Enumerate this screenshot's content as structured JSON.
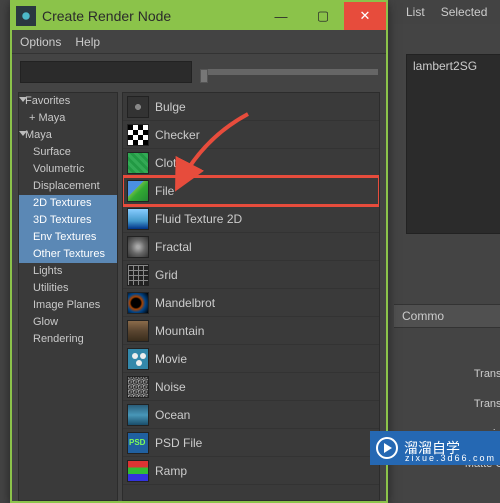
{
  "window": {
    "title": "Create Render Node",
    "min_glyph": "—",
    "max_glyph": "▢",
    "close_glyph": "✕"
  },
  "menu": {
    "options": "Options",
    "help": "Help"
  },
  "sidebar": {
    "items": [
      "Favorites",
      "+ Maya",
      "Maya",
      "Surface",
      "Volumetric",
      "Displacement",
      "2D Textures",
      "3D Textures",
      "Env Textures",
      "Other Textures",
      "Lights",
      "Utilities",
      "Image Planes",
      "Glow",
      "Rendering"
    ]
  },
  "content": {
    "items": [
      "Bulge",
      "Checker",
      "Cloth",
      "File",
      "Fluid Texture 2D",
      "Fractal",
      "Grid",
      "Mandelbrot",
      "Mountain",
      "Movie",
      "Noise",
      "Ocean",
      "PSD File",
      "Ramp"
    ]
  },
  "right": {
    "list_tab": "List",
    "selected_tab": "Selected",
    "list_item": "lambert2SG",
    "common_header": "Commo",
    "transl1": "Transl",
    "transl2": "Transl",
    "special": "ecial",
    "matte": "Matte O"
  },
  "watermark": {
    "text": "溜溜自学",
    "sub": "zixue.3d66.com"
  }
}
